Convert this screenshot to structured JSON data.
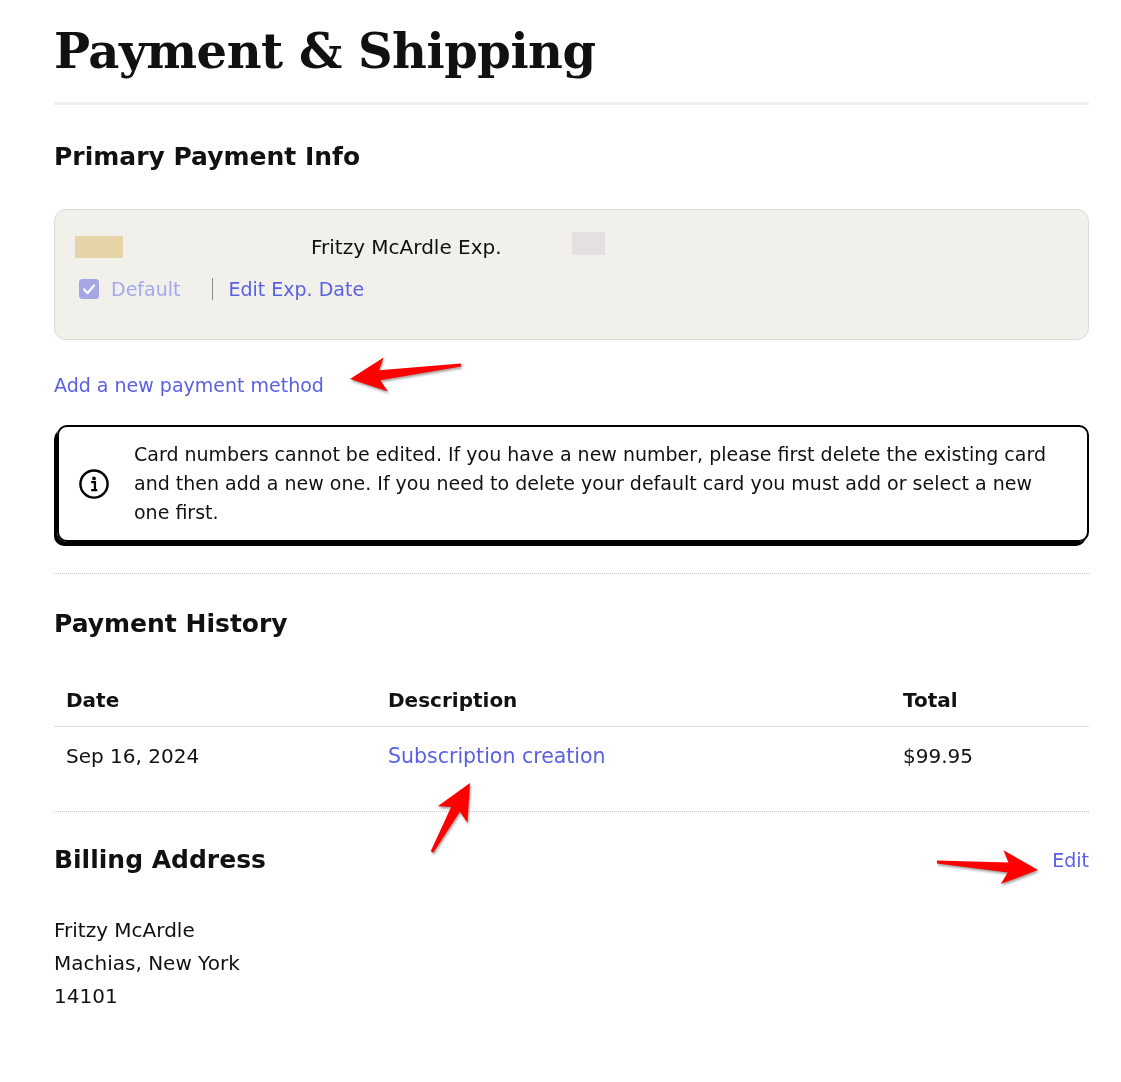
{
  "page": {
    "title": "Payment & Shipping"
  },
  "primary_payment": {
    "heading": "Primary Payment Info",
    "cards": [
      {
        "name": "Fritzy McArdle Exp.",
        "default": {
          "label": "Default",
          "checked": true,
          "disabled": true
        },
        "edit_link": "Edit Exp. Date"
      }
    ],
    "add_link": "Add a new payment method",
    "notice": "Card numbers cannot be edited. If you have a new number, please first delete the existing card and then add a new one. If you need to delete your default card you must add or select a new one first."
  },
  "payment_history": {
    "heading": "Payment History",
    "columns": [
      "Date",
      "Description",
      "Total"
    ],
    "rows": [
      {
        "cells": [
          {
            "kind": "text",
            "text": "Sep 16, 2024"
          },
          {
            "kind": "link",
            "text": "Subscription creation"
          },
          {
            "kind": "text",
            "text": "$99.95"
          }
        ]
      }
    ]
  },
  "billing_address": {
    "heading": "Billing Address",
    "edit_link": "Edit",
    "lines": [
      "Fritzy McArdle",
      "Machias, New York",
      "14101"
    ]
  }
}
